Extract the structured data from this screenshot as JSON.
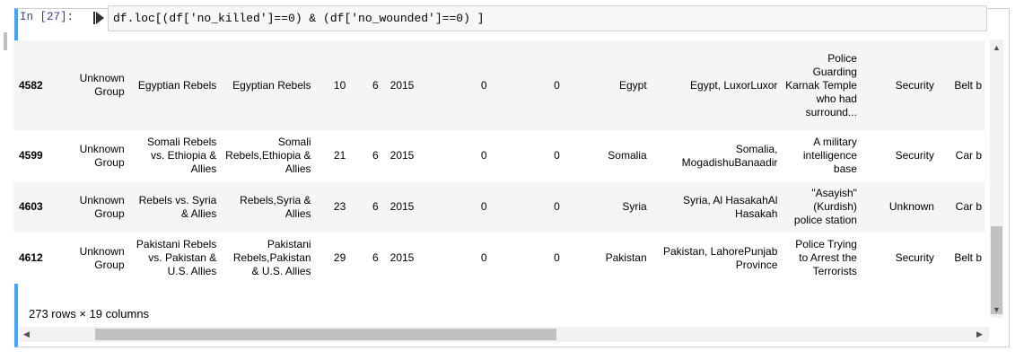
{
  "cell": {
    "prompt": "In [27]:",
    "code": "df.loc[(df['no_killed']==0) & (df['no_wounded']==0) ]"
  },
  "table": {
    "rows": [
      [
        "4582",
        "Unknown Group",
        "Egyptian Rebels",
        "Egyptian Rebels",
        "10",
        "6",
        "2015",
        "0",
        "0",
        "Egypt",
        "Egypt, LuxorLuxor",
        "Police Guarding Karnak Temple who had surround...",
        "Security",
        "Belt b"
      ],
      [
        "4599",
        "Unknown Group",
        "Somali Rebels vs. Ethiopia & Allies",
        "Somali Rebels,Ethiopia & Allies",
        "21",
        "6",
        "2015",
        "0",
        "0",
        "Somalia",
        "Somalia, MogadishuBanaadir",
        "A military intelligence base",
        "Security",
        "Car b"
      ],
      [
        "4603",
        "Unknown Group",
        "Rebels vs. Syria & Allies",
        "Rebels,Syria & Allies",
        "23",
        "6",
        "2015",
        "0",
        "0",
        "Syria",
        "Syria, Al HasakahAl Hasakah",
        "\"Asayish\" (Kurdish) police station",
        "Unknown",
        "Car b"
      ],
      [
        "4612",
        "Unknown Group",
        "Pakistani Rebels vs. Pakistan & U.S. Allies",
        "Pakistani Rebels,Pakistan & U.S. Allies",
        "29",
        "6",
        "2015",
        "0",
        "0",
        "Pakistan",
        "Pakistan, LahorePunjab Province",
        "Police Trying to Arrest the Terrorists",
        "Security",
        "Belt b"
      ]
    ]
  },
  "shape_text": "273 rows × 19 columns",
  "colors": {
    "accent": "#42a5f5",
    "prompt": "#303f9f",
    "stripe": "#f5f5f5"
  }
}
